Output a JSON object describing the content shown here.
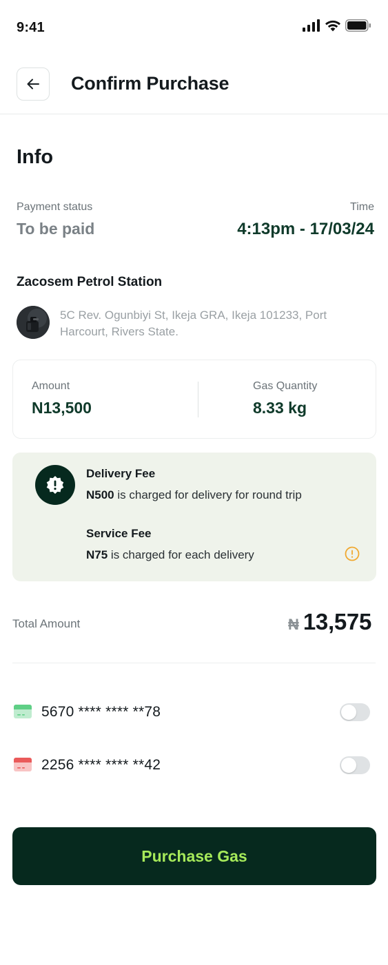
{
  "status_bar": {
    "time": "9:41",
    "icons": [
      "signal-icon",
      "wifi-icon",
      "battery-icon"
    ]
  },
  "header": {
    "back_icon": "arrow-left-icon",
    "title": "Confirm Purchase"
  },
  "info": {
    "title": "Info",
    "payment_status_label": "Payment status",
    "payment_status_value": "To be paid",
    "time_label": "Time",
    "time_value": "4:13pm - 17/03/24"
  },
  "station": {
    "name": "Zacosem Petrol Station",
    "address": "5C Rev. Ogunbiyi St, Ikeja GRA, Ikeja 101233, Port Harcourt, Rivers State."
  },
  "stats": {
    "amount_label": "Amount",
    "amount_value": "N13,500",
    "quantity_label": "Gas Quantity",
    "quantity_value": "8.33 kg"
  },
  "fees": {
    "delivery_title": "Delivery Fee",
    "delivery_amount": "N500",
    "delivery_text": "is charged for delivery for round trip",
    "service_title": "Service Fee",
    "service_amount": "N75",
    "service_text": "is charged for each delivery"
  },
  "total": {
    "label": "Total Amount",
    "currency": "₦",
    "value": "13,575"
  },
  "cards": [
    {
      "number": "5670 **** **** **78",
      "color": "#5fcf86",
      "enabled": false
    },
    {
      "number": "2256 **** **** **42",
      "color": "#ea5a5a",
      "enabled": false
    }
  ],
  "actions": {
    "purchase_label": "Purchase Gas"
  },
  "colors": {
    "brand_dark": "#06291e",
    "brand_green_text": "#a6ea5a",
    "value_green": "#0f3a2a",
    "fee_card_bg": "#eff3eb",
    "warning": "#f0a830"
  }
}
